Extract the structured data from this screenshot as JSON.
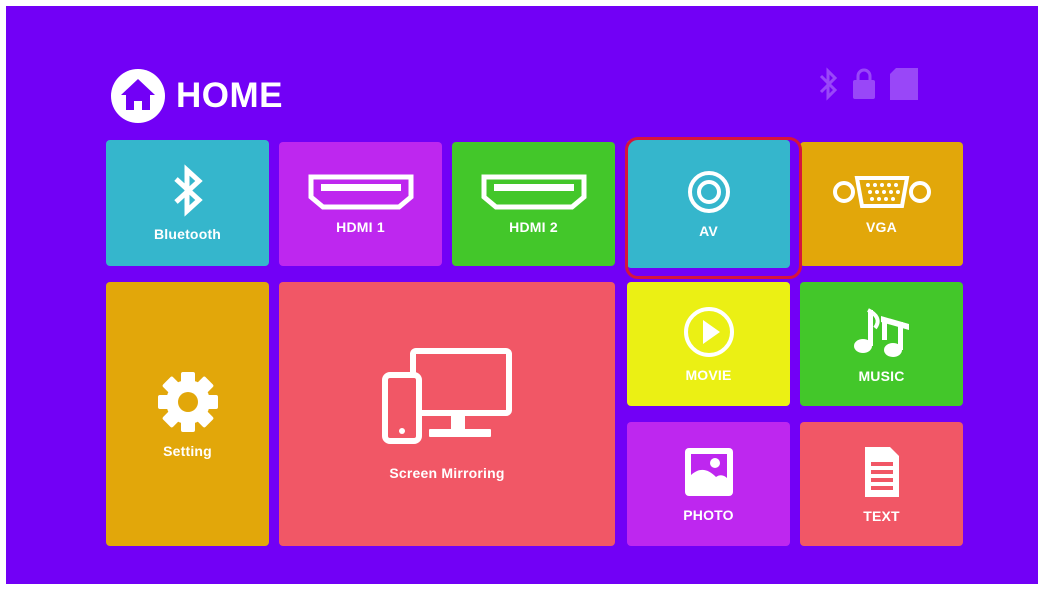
{
  "header": {
    "title": "HOME",
    "icon": "home-icon"
  },
  "status_icons": [
    "bluetooth-icon",
    "lock-icon",
    "storage-icon"
  ],
  "tiles": {
    "bluetooth": {
      "label": "Bluetooth",
      "icon": "bluetooth-icon",
      "color": "#35b6cc"
    },
    "hdmi1": {
      "label": "HDMI 1",
      "icon": "hdmi-icon",
      "color": "#be27ef"
    },
    "hdmi2": {
      "label": "HDMI 2",
      "icon": "hdmi-icon",
      "color": "#43c72a"
    },
    "av": {
      "label": "AV",
      "icon": "av-icon",
      "color": "#35b6cc",
      "focused": true
    },
    "vga": {
      "label": "VGA",
      "icon": "vga-icon",
      "color": "#e2a70a"
    },
    "setting": {
      "label": "Setting",
      "icon": "gear-icon",
      "color": "#e2a70a"
    },
    "screen_mirroring": {
      "label": "Screen Mirroring",
      "icon": "screen-mirroring-icon",
      "color": "#f15766"
    },
    "movie": {
      "label": "MOVIE",
      "icon": "play-icon",
      "color": "#ebf014"
    },
    "music": {
      "label": "MUSIC",
      "icon": "music-note-icon",
      "color": "#43c72a"
    },
    "photo": {
      "label": "PHOTO",
      "icon": "photo-icon",
      "color": "#be27ef"
    },
    "text": {
      "label": "TEXT",
      "icon": "document-icon",
      "color": "#f15766"
    }
  },
  "colors": {
    "background": "#7200f6",
    "focus_border": "#d6153c"
  }
}
